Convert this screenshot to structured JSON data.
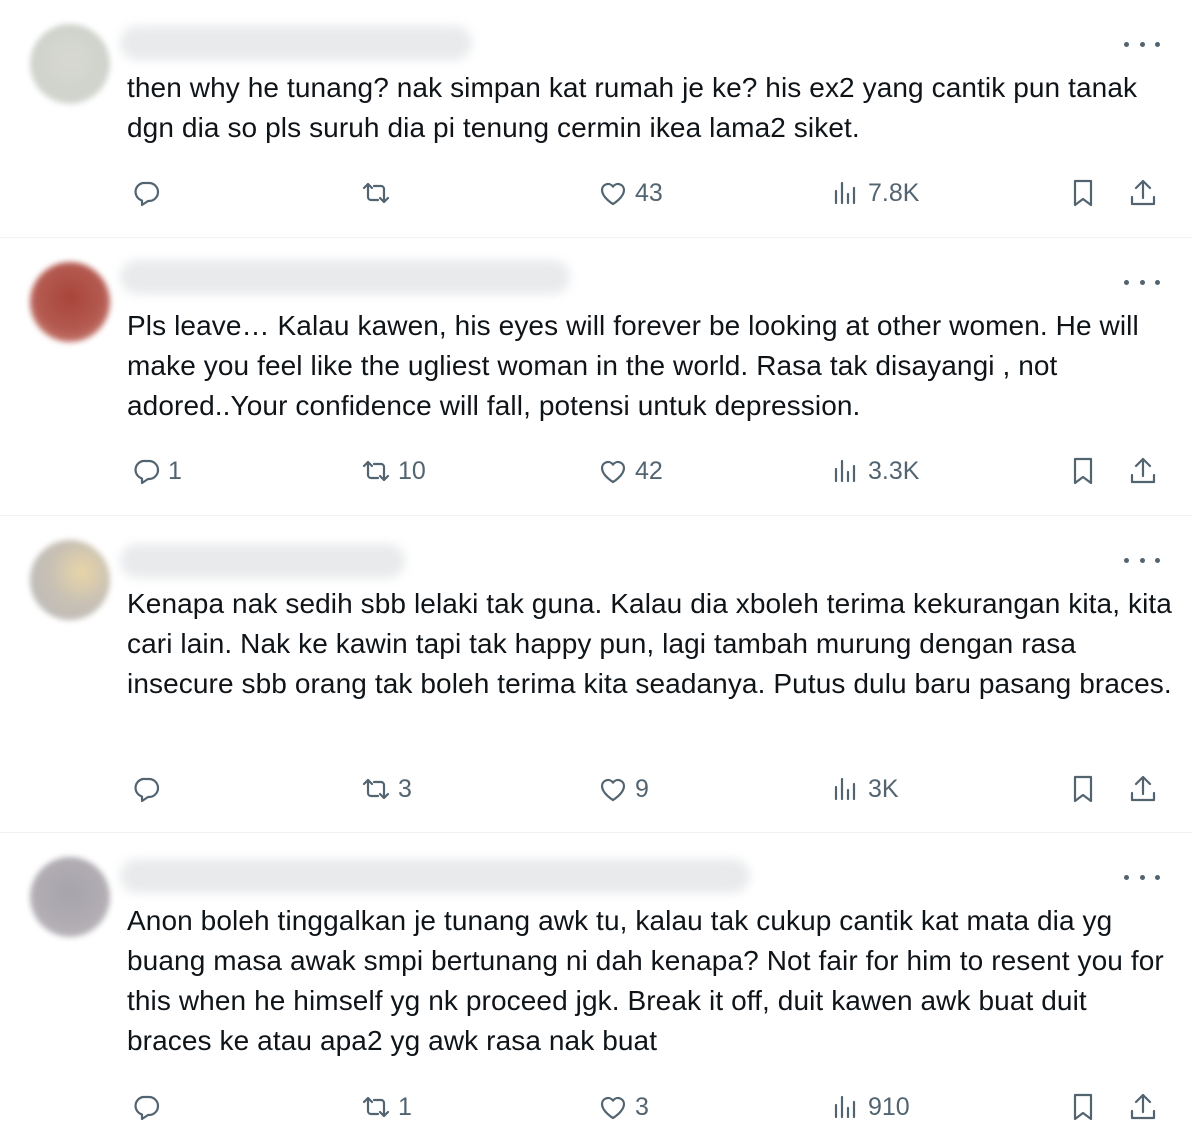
{
  "tweets": [
    {
      "text": "then why he tunang? nak simpan kat rumah je ke? his ex2 yang cantik pun tanak dgn dia so pls suruh dia pi tenung cermin ikea lama2 siket.",
      "reply_count": "",
      "retweet_count": "",
      "like_count": "43",
      "view_count": "7.8K"
    },
    {
      "text": "Pls leave… Kalau kawen, his eyes will forever be looking at other women. He will make you feel like the ugliest woman in the world. Rasa tak disayangi , not adored..Your confidence will fall, potensi untuk depression.",
      "reply_count": "1",
      "retweet_count": "10",
      "like_count": "42",
      "view_count": "3.3K"
    },
    {
      "text": "Kenapa nak sedih sbb lelaki tak guna. Kalau dia xboleh terima kekurangan kita, kita cari lain. Nak ke kawin tapi tak happy pun, lagi tambah murung dengan rasa insecure sbb orang tak boleh terima kita seadanya. Putus dulu baru pasang braces.",
      "reply_count": "",
      "retweet_count": "3",
      "like_count": "9",
      "view_count": "3K"
    },
    {
      "text": "Anon boleh tinggalkan je tunang awk tu, kalau tak cukup cantik kat mata dia yg buang masa awak smpi bertunang ni dah kenapa? Not fair for him to resent you for this when he himself yg nk proceed jgk. Break it off, duit kawen awk buat duit braces ke atau apa2 yg awk rasa nak buat",
      "reply_count": "",
      "retweet_count": "1",
      "like_count": "3",
      "view_count": "910"
    }
  ],
  "icons": {
    "reply": "reply-icon",
    "retweet": "retweet-icon",
    "like": "like-icon",
    "views": "views-icon",
    "bookmark": "bookmark-icon",
    "share": "share-icon",
    "more": "more-icon"
  },
  "colors": {
    "text": "#0f1419",
    "icon": "#536471",
    "divider": "#eff3f4"
  }
}
